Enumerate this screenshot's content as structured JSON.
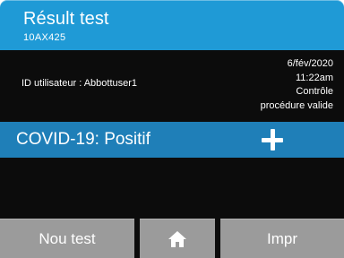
{
  "header": {
    "title": "Résult test",
    "test_id": "10AX425"
  },
  "info": {
    "user": "ID utilisateur : Abbottuser1",
    "date": "6/fév/2020",
    "time": "11:22am",
    "control": "Contrôle",
    "procedure": "procédure valide"
  },
  "result": {
    "label": "COVID-19: Positif",
    "icon": "plus-icon"
  },
  "footer": {
    "new_test": "Nou test",
    "home_icon": "home-icon",
    "print": "Impr"
  },
  "colors": {
    "header_blue": "#1f9ad6",
    "result_blue": "#1f7fb8",
    "panel_black": "#0c0c0c",
    "button_gray": "#9b9b9b"
  }
}
